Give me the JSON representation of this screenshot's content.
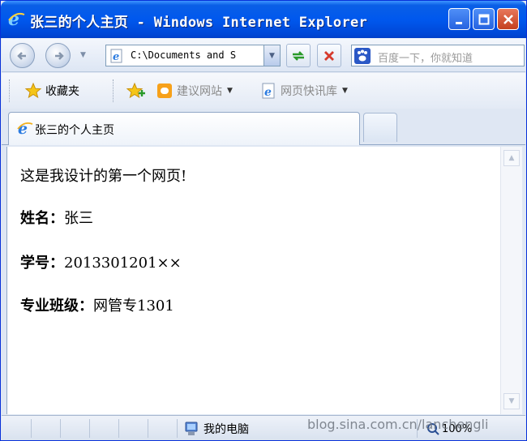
{
  "window": {
    "title": "张三的个人主页 - Windows Internet Explorer",
    "colors": {
      "titlebar": "#0058ee",
      "close": "#c4401f",
      "chrome": "#dfe7f3"
    }
  },
  "nav": {
    "address": "C:\\Documents and S",
    "search_placeholder": "百度一下，你就知道"
  },
  "favorites": {
    "label": "收藏夹",
    "items": [
      {
        "label": "建议网站",
        "icon": "suggested-sites-icon"
      },
      {
        "label": "网页快讯库",
        "icon": "web-slice-icon"
      }
    ]
  },
  "tab": {
    "label": "张三的个人主页"
  },
  "page": {
    "intro": "这是我设计的第一个网页!",
    "rows": [
      {
        "label": "姓名：",
        "value": "张三"
      },
      {
        "label": "学号：",
        "value": "2013301201××"
      },
      {
        "label": "专业班级：",
        "value": "网管专1301"
      }
    ]
  },
  "status": {
    "zone": "我的电脑",
    "zoom": "100%",
    "watermark": "blog.sina.com.cn/lanchengli"
  }
}
